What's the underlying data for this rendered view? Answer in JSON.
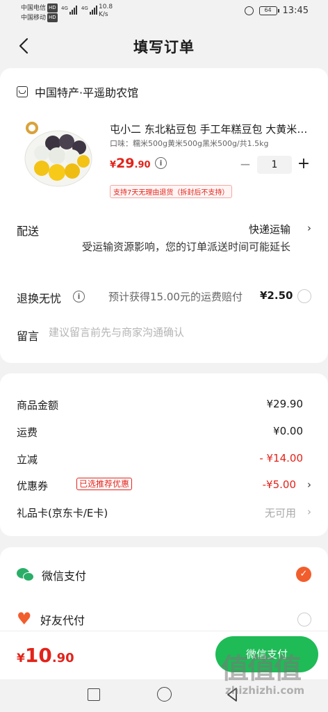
{
  "status_bar": {
    "carrier1": "中国电信",
    "carrier2": "中国移动",
    "hd": "HD",
    "signal": "4G",
    "speed_value": "10.8",
    "speed_unit": "K/s",
    "battery": "64",
    "time": "13:45"
  },
  "header": {
    "title": "填写订单"
  },
  "shop": {
    "name": "中国特产·平遥助农馆"
  },
  "product": {
    "title": "屯小二 东北粘豆包 手工年糕豆包 大黄米粘豆包",
    "spec": "口味：糯米500g黄米500g黑米500g/共1.5kg",
    "price_symbol": "¥",
    "price_int": "29",
    "price_dec": ".90",
    "quantity": "1",
    "return_policy": "支持7天无理由退货（拆封后不支持）"
  },
  "delivery": {
    "label": "配送",
    "method": "快递运输",
    "note": "受运输资源影响，您的订单派送时间可能延长"
  },
  "return_insurance": {
    "label": "退换无忧",
    "desc": "预计获得15.00元的运费赔付",
    "price": "¥2.50"
  },
  "remark": {
    "label": "留言",
    "placeholder": "建议留言前先与商家沟通确认"
  },
  "summary": {
    "goods_label": "商品金额",
    "goods_value": "¥29.90",
    "shipping_label": "运费",
    "shipping_value": "¥0.00",
    "discount_label": "立减",
    "discount_value": "- ¥14.00",
    "coupon_label": "优惠券",
    "coupon_badge": "已选推荐优惠",
    "coupon_value": "-¥5.00",
    "giftcard_label": "礼品卡(京东卡/E卡)",
    "giftcard_value": "无可用"
  },
  "payment": {
    "wechat_label": "微信支付",
    "friend_label": "好友代付"
  },
  "bottom": {
    "symbol": "¥",
    "total_int": "10",
    "total_dec": ".90",
    "pay_button": "微信支付"
  },
  "watermark": {
    "big": "值值值",
    "small": "zhizhizhi.com"
  },
  "colors": {
    "accent_red": "#e2231a",
    "pay_green": "#1fbb57",
    "check_orange": "#f25d2c"
  }
}
